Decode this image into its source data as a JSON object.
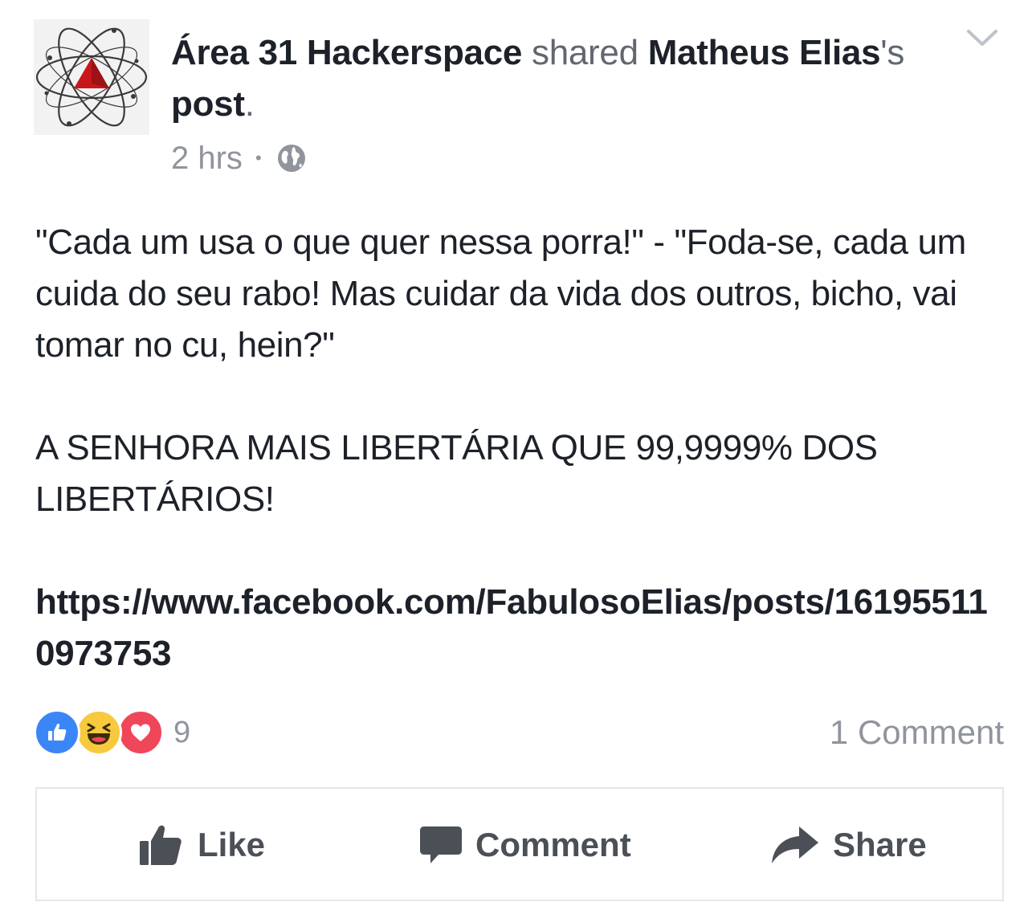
{
  "post": {
    "page_name": "Área 31 Hackerspace",
    "action_word": "shared",
    "shared_author": "Matheus Elias",
    "possessive": "'s",
    "post_word": "post",
    "period": ".",
    "time": "2 hrs",
    "separator": "•",
    "privacy_icon": "globe-icon",
    "body": {
      "paragraph_1": "\"Cada um usa o que quer nessa porra!\" - \"Foda-se, cada um cuida do seu rabo! Mas cuidar da vida dos outros, bicho, vai tomar no cu, hein?\"",
      "paragraph_2": "A SENHORA MAIS LIBERTÁRIA QUE 99,9999% DOS LIBERTÁRIOS!",
      "link": "https://www.facebook.com/FabulosoElias/posts/161955110973753"
    },
    "reactions": {
      "types": [
        "like",
        "haha",
        "love"
      ],
      "count": "9"
    },
    "comments_label": "1 Comment"
  },
  "actions": {
    "like_label": "Like",
    "comment_label": "Comment",
    "share_label": "Share"
  },
  "colors": {
    "text": "#1d2129",
    "muted": "#90949c",
    "like_blue": "#3b86f6",
    "haha_yellow": "#f7c93f",
    "love_red": "#ef4659",
    "action_gray": "#4b4f56"
  }
}
